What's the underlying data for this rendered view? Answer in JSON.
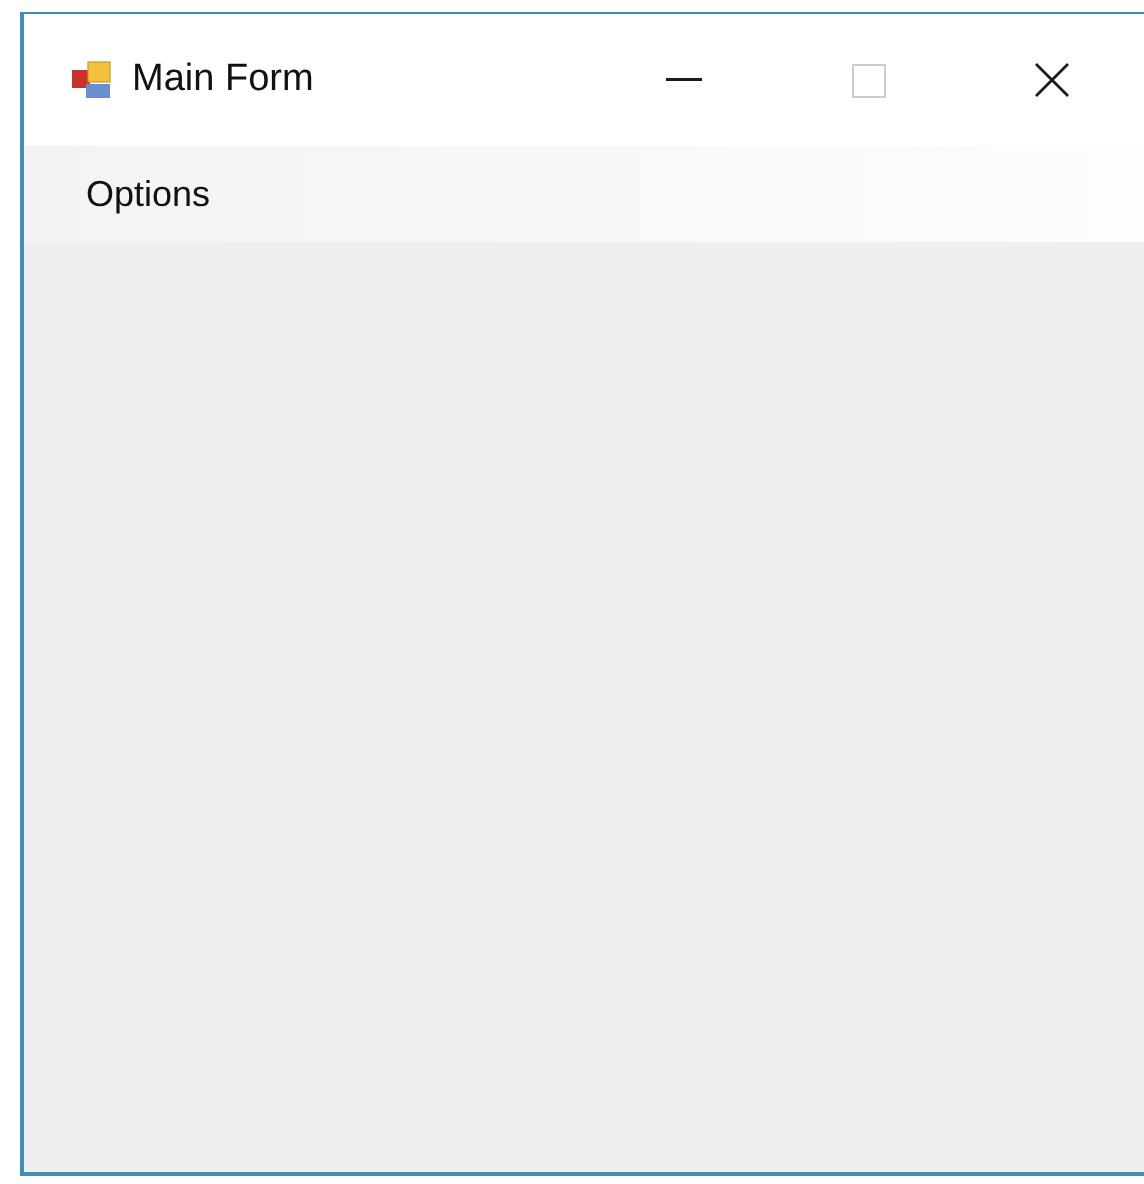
{
  "window": {
    "title": "Main Form",
    "caption_buttons": [
      {
        "kind": "minimize",
        "disabled": false
      },
      {
        "kind": "maximize",
        "disabled": true
      },
      {
        "kind": "close",
        "disabled": false
      }
    ]
  },
  "menu": [
    {
      "label": "Options"
    }
  ]
}
